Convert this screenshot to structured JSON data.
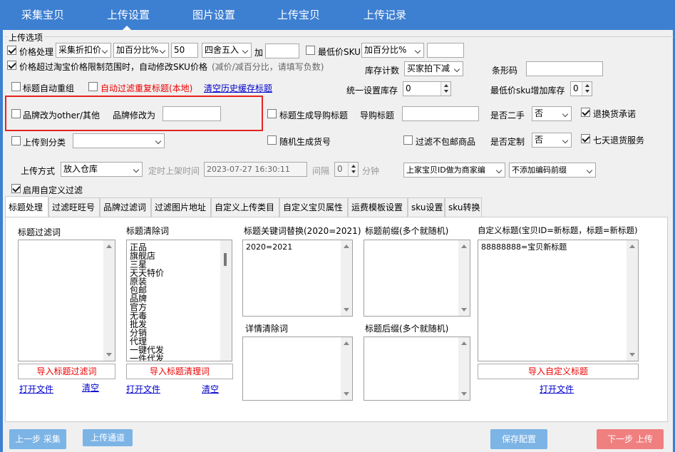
{
  "nav": {
    "tabs": [
      {
        "label": "采集宝贝"
      },
      {
        "label": "上传设置"
      },
      {
        "label": "图片设置"
      },
      {
        "label": "上传宝贝"
      },
      {
        "label": "上传记录"
      }
    ]
  },
  "upload_options": {
    "group_title": "上传选项",
    "price_handling": {
      "label": "价格处理",
      "checked": true,
      "mode": "采集折扣价",
      "type": "加百分比%",
      "value": "50",
      "rounding": "四舍五入",
      "add_label": "加",
      "add_value": ""
    },
    "min_price_sku": {
      "label": "最低价SKU",
      "checked": false,
      "type": "加百分比%",
      "value": ""
    },
    "auto_modify_sku": {
      "label": "价格超过淘宝价格限制范围时，自动修改SKU价格",
      "hint": "(减价/减百分比，请填写负数)",
      "checked": true
    },
    "inventory_count": {
      "label": "库存计数",
      "value": "买家拍下减"
    },
    "barcode": {
      "label": "条形码",
      "value": ""
    },
    "title_regroup": {
      "label": "标题自动重组",
      "checked": false
    },
    "auto_filter_dup": {
      "label": "自动过滤重复标题(本地)",
      "checked": false
    },
    "clear_history_link": "清空历史缓存标题",
    "unified_stock": {
      "label": "统一设置库存",
      "value": "0"
    },
    "min_price_sku_stock": {
      "label": "最低价sku增加库存",
      "value": "0"
    },
    "brand_other": {
      "label": "品牌改为other/其他",
      "checked": false
    },
    "brand_modify": {
      "label": "品牌修改为",
      "value": ""
    },
    "title_gen_shopping": {
      "label": "标题生成导购标题",
      "checked": false
    },
    "shopping_title": {
      "label": "导购标题",
      "value": ""
    },
    "second_hand": {
      "label": "是否二手",
      "value": "否"
    },
    "return_promise": {
      "label": "退换货承诺",
      "checked": true
    },
    "upload_category": {
      "label": "上传到分类",
      "checked": false,
      "value": ""
    },
    "random_item_no": {
      "label": "随机生成货号",
      "checked": false
    },
    "filter_no_shipping": {
      "label": "过滤不包邮商品",
      "checked": false
    },
    "customized": {
      "label": "是否定制",
      "value": "否"
    },
    "seven_day_return": {
      "label": "七天退货服务",
      "checked": true
    },
    "upload_method": {
      "label": "上传方式",
      "value": "放入仓库"
    },
    "timed_listing": {
      "label": "定时上架时间",
      "value": "2023-07-27 16:30:11"
    },
    "interval": {
      "label": "间隔",
      "value": "0",
      "unit": "分钟"
    },
    "merchant_code": {
      "value": "上家宝贝ID做为商家编"
    },
    "encoding_prefix": {
      "value": "不添加编码前缀"
    },
    "custom_filter": {
      "label": "启用自定义过滤",
      "checked": true
    }
  },
  "tabs": [
    {
      "label": "标题处理"
    },
    {
      "label": "过滤旺旺号"
    },
    {
      "label": "品牌过滤词"
    },
    {
      "label": "过滤图片地址"
    },
    {
      "label": "自定义上传类目"
    },
    {
      "label": "自定义宝贝属性"
    },
    {
      "label": "运费模板设置"
    },
    {
      "label": "sku设置"
    },
    {
      "label": "sku转换"
    }
  ],
  "title_panel": {
    "title_filter": {
      "label": "标题过滤词",
      "content": "",
      "import_button": "导入标题过滤词",
      "open_file": "打开文件",
      "clear": "清空"
    },
    "title_clear": {
      "label": "标题清除词",
      "content": "正品\n旗舰店\n三星\n天天特价\n原装\n包邮\n品牌\n官方\n无毒\n批发\n分销\n代理\n一键代发\n一件代发",
      "import_button": "导入标题清理词",
      "open_file": "打开文件",
      "clear": "清空"
    },
    "keyword_replace": {
      "label": "标题关键词替换(2020=2021)",
      "content": "2020=2021"
    },
    "detail_clear": {
      "label": "详情清除词",
      "content": ""
    },
    "title_prefix": {
      "label": "标题前缀(多个就随机)",
      "content": ""
    },
    "title_suffix": {
      "label": "标题后缀(多个就随机)",
      "content": ""
    },
    "custom_title": {
      "label": "自定义标题(宝贝ID=新标题，标题=新标题)",
      "content": "88888888=宝贝新标题",
      "import_button": "导入自定义标题",
      "open_file": "打开文件"
    }
  },
  "footer": {
    "prev_button": "上一步 采集",
    "upload_channel_button": "上传通道",
    "save_button": "保存配置",
    "next_button": "下一步 上传"
  },
  "colors": {
    "nav_bg": "#3d7fd1",
    "accent_red": "#e52420",
    "button_blue": "#7cb4e6",
    "button_red": "#f08080",
    "link_blue": "#0000cc"
  }
}
